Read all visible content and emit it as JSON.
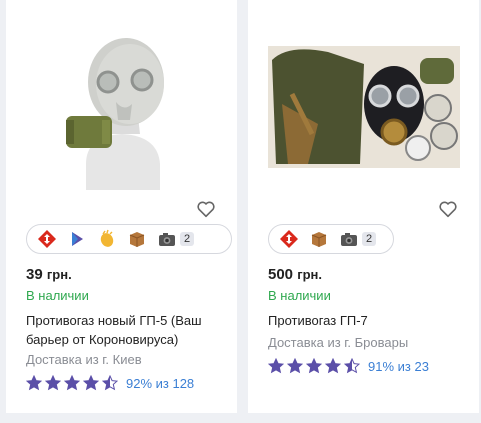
{
  "colors": {
    "accent_star": "#5b4fa8",
    "in_stock": "#2fa84f",
    "rating_link": "#3b7fd4",
    "muted_text": "#8a8d94"
  },
  "products": [
    {
      "image": "gas-mask-gp5-on-mannequin",
      "badges": [
        "nova-poshta-icon",
        "delivery-arrow-icon",
        "clap-icon",
        "box-icon",
        "camera-icon"
      ],
      "photo_count": "2",
      "price": "39",
      "currency": "грн.",
      "stock": "В наличии",
      "title": "Противогаз новый ГП-5 (Ваш барьер от Короновируса)",
      "delivery": "Доставка из г. Киев",
      "stars": 4.5,
      "rating_text": "92% из 128"
    },
    {
      "image": "gas-mask-gp7-kit",
      "badges": [
        "nova-poshta-icon",
        "box-icon",
        "camera-icon"
      ],
      "photo_count": "2",
      "price": "500",
      "currency": "грн.",
      "stock": "В наличии",
      "title": "Противогаз ГП-7",
      "delivery": "Доставка из г. Бровары",
      "stars": 4.5,
      "rating_text": "91% из 23"
    }
  ]
}
